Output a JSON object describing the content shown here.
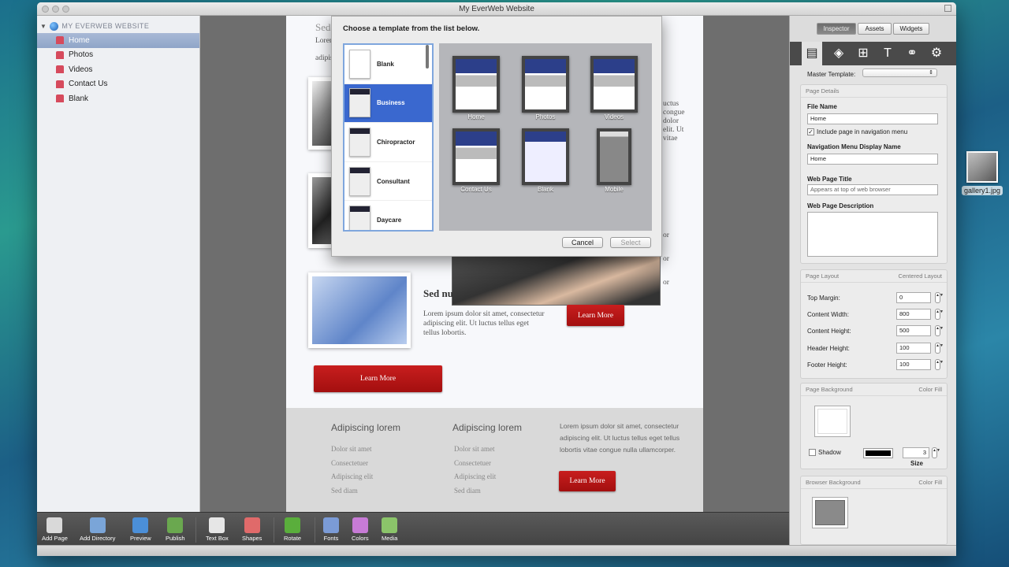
{
  "window": {
    "title": "My EverWeb Website"
  },
  "sidebar": {
    "site_name": "MY EVERWEB WEBSITE",
    "pages": [
      {
        "label": "Home",
        "selected": true
      },
      {
        "label": "Photos"
      },
      {
        "label": "Videos"
      },
      {
        "label": "Contact Us"
      },
      {
        "label": "Blank"
      }
    ]
  },
  "site_page": {
    "top_heading": "Sed",
    "top_text_1": "Lorem",
    "top_text_2": "adipis",
    "right_text": [
      "uctus",
      "congue",
      "dolor",
      "elit. Ut",
      "vitae"
    ],
    "or_text": [
      "or",
      "or",
      "or"
    ],
    "section_heading": "Sed nu",
    "section_text": "Lorem ipsum dolor sit amet, consectetur adipiscing elit. Ut luctus tellus eget tellus lobortis.",
    "learn_more_small": "Learn More",
    "learn_more_big": "Learn More",
    "footer": {
      "col1_title": "Adipiscing lorem",
      "col1_links": [
        "Dolor sit amet",
        "Consectetuer",
        "Adipiscing elit",
        "Sed diam"
      ],
      "col2_title": "Adipiscing lorem",
      "col2_links": [
        "Dolor sit amet",
        "Consectetuer",
        "Adipiscing elit",
        "Sed diam"
      ],
      "paragraph": "Lorem ipsum dolor sit amet, consectetur adipiscing elit. Ut luctus tellus eget tellus lobortis vitae congue nulla ullamcorper.",
      "learn_more": "Learn More"
    }
  },
  "dialog": {
    "title": "Choose a template from the list below.",
    "templates": [
      {
        "label": "Blank"
      },
      {
        "label": "Business",
        "selected": true
      },
      {
        "label": "Chiropractor"
      },
      {
        "label": "Consultant"
      },
      {
        "label": "Daycare"
      }
    ],
    "previews": [
      "Home",
      "Photos",
      "Videos",
      "Contact Us",
      "Blank",
      "Mobile"
    ],
    "cancel": "Cancel",
    "select": "Select"
  },
  "inspector": {
    "tabs": [
      "Inspector",
      "Assets",
      "Widgets"
    ],
    "active_tab": "Inspector",
    "icons": [
      "page-icon",
      "shape-icon",
      "layout-icon",
      "text-icon",
      "link-icon",
      "settings-icon"
    ],
    "master_template_label": "Master Template:",
    "page_details": "Page Details",
    "file_name_label": "File Name",
    "file_name": "Home",
    "include_nav_label": "Include page in navigation menu",
    "include_nav_checked": true,
    "nav_display_name_label": "Navigation Menu Display Name",
    "nav_display_name": "Home",
    "web_page_title_label": "Web Page Title",
    "web_page_title_placeholder": "Appears at top of web browser",
    "web_page_description_label": "Web Page Description",
    "page_layout": "Page Layout",
    "page_layout_mode": "Centered Layout",
    "layout_fields": [
      {
        "label": "Top Margin:",
        "value": "0"
      },
      {
        "label": "Content Width:",
        "value": "800"
      },
      {
        "label": "Content Height:",
        "value": "500"
      },
      {
        "label": "Header Height:",
        "value": "100"
      },
      {
        "label": "Footer Height:",
        "value": "100"
      }
    ],
    "page_background": "Page Background",
    "page_bg_fill": "Color Fill",
    "shadow_label": "Shadow",
    "shadow_size": "3",
    "size_label": "Size",
    "browser_background": "Browser Background",
    "browser_bg_fill": "Color Fill",
    "page_bg_color": "#ffffff",
    "shadow_color": "#000000",
    "browser_bg_color": "#8a8a8a"
  },
  "toolbar": [
    {
      "label": "Add Page",
      "icon": "add-page-icon",
      "color": "#d9d9d9"
    },
    {
      "label": "Add Directory",
      "icon": "add-directory-icon",
      "color": "#7aa5d8"
    },
    {
      "label": "Preview",
      "icon": "preview-icon",
      "color": "#4b8fd8"
    },
    {
      "label": "Publish",
      "icon": "publish-icon",
      "color": "#6aa84f"
    },
    {
      "label": "Text Box",
      "icon": "text-box-icon",
      "color": "#e6e6e6"
    },
    {
      "label": "Shapes",
      "icon": "shapes-icon",
      "color": "#e06a6a"
    },
    {
      "label": "Rotate",
      "icon": "rotate-icon",
      "color": "#5aae3c"
    },
    {
      "label": "Fonts",
      "icon": "fonts-icon",
      "color": "#7b9bd6"
    },
    {
      "label": "Colors",
      "icon": "colors-icon",
      "color": "#c77bd6"
    },
    {
      "label": "Media",
      "icon": "media-icon",
      "color": "#8bc46a"
    }
  ],
  "desktop": {
    "file_name": "gallery1.jpg"
  }
}
